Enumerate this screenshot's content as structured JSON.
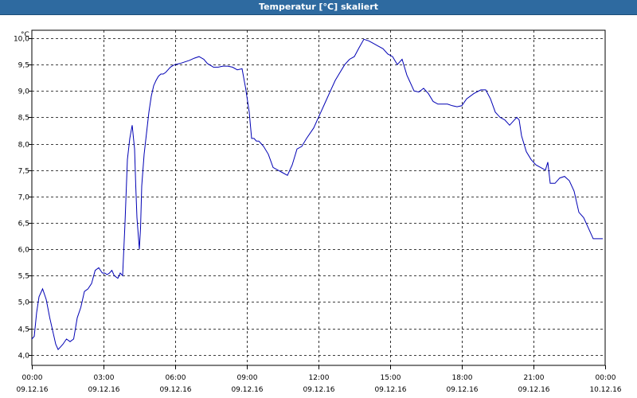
{
  "window": {
    "title": "Temperatur [°C] skaliert"
  },
  "chart_data": {
    "type": "line",
    "title": "Temperatur [°C] skaliert",
    "ylabel": "°C",
    "xlabel": "",
    "ylim": [
      3.8,
      10.15
    ],
    "xlim": [
      0,
      24
    ],
    "grid": true,
    "line_color": "#0000b4",
    "yticks": [
      4.0,
      4.5,
      5.0,
      5.5,
      6.0,
      6.5,
      7.0,
      7.5,
      8.0,
      8.5,
      9.0,
      9.5,
      10.0
    ],
    "ytick_labels": [
      "4,0",
      "4,5",
      "5,0",
      "5,5",
      "6,0",
      "6,5",
      "7,0",
      "7,5",
      "8,0",
      "8,5",
      "9,0",
      "9,5",
      "10,0"
    ],
    "xticks": [
      {
        "hour": 0,
        "time": "00:00",
        "date": "09.12.16"
      },
      {
        "hour": 3,
        "time": "03:00",
        "date": "09.12.16"
      },
      {
        "hour": 6,
        "time": "06:00",
        "date": "09.12.16"
      },
      {
        "hour": 9,
        "time": "09:00",
        "date": "09.12.16"
      },
      {
        "hour": 12,
        "time": "12:00",
        "date": "09.12.16"
      },
      {
        "hour": 15,
        "time": "15:00",
        "date": "09.12.16"
      },
      {
        "hour": 18,
        "time": "18:00",
        "date": "09.12.16"
      },
      {
        "hour": 21,
        "time": "21:00",
        "date": "09.12.16"
      },
      {
        "hour": 24,
        "time": "00:00",
        "date": "10.12.16"
      }
    ],
    "series": [
      {
        "x": [
          0.0,
          0.1,
          0.2,
          0.3,
          0.45,
          0.6,
          0.75,
          0.9,
          1.0,
          1.1,
          1.2,
          1.3,
          1.45,
          1.6,
          1.75,
          1.9,
          2.05,
          2.2,
          2.35,
          2.5,
          2.65,
          2.8,
          2.95,
          3.05,
          3.15,
          3.25,
          3.35,
          3.45,
          3.6,
          3.7,
          3.8,
          3.9,
          4.0,
          4.1,
          4.2,
          4.3,
          4.35,
          4.4,
          4.5,
          4.55,
          4.6,
          4.7,
          4.8,
          4.9,
          5.0,
          5.1,
          5.2,
          5.3,
          5.4,
          5.5,
          5.6,
          5.7,
          5.8,
          5.9,
          6.0,
          6.2,
          6.4,
          6.6,
          6.8,
          7.0,
          7.2,
          7.35,
          7.5,
          7.6,
          7.8,
          8.0,
          8.2,
          8.4,
          8.6,
          8.8,
          8.95,
          9.1,
          9.2,
          9.3,
          9.4,
          9.5,
          9.6,
          9.7,
          9.9,
          10.1,
          10.3,
          10.5,
          10.7,
          10.9,
          11.1,
          11.3,
          11.5,
          11.8,
          11.95,
          12.1,
          12.3,
          12.5,
          12.7,
          12.9,
          13.1,
          13.3,
          13.5,
          13.7,
          13.9,
          14.1,
          14.3,
          14.5,
          14.7,
          14.9,
          15.1,
          15.3,
          15.5,
          15.6,
          15.7,
          15.8,
          15.9,
          16.0,
          16.2,
          16.4,
          16.6,
          16.8,
          17.0,
          17.2,
          17.4,
          17.6,
          17.8,
          18.0,
          18.2,
          18.5,
          18.8,
          19.0,
          19.2,
          19.4,
          19.6,
          19.8,
          20.0,
          20.2,
          20.3,
          20.4,
          20.5,
          20.7,
          20.9,
          21.1,
          21.3,
          21.5,
          21.6,
          21.7,
          21.9,
          22.1,
          22.3,
          22.5,
          22.7,
          22.9,
          23.1,
          23.3,
          23.5,
          23.7,
          23.9
        ],
        "y": [
          4.3,
          4.35,
          4.8,
          5.1,
          5.25,
          5.05,
          4.7,
          4.4,
          4.2,
          4.1,
          4.15,
          4.2,
          4.3,
          4.25,
          4.3,
          4.7,
          4.9,
          5.2,
          5.25,
          5.35,
          5.6,
          5.65,
          5.55,
          5.55,
          5.52,
          5.55,
          5.6,
          5.5,
          5.45,
          5.55,
          5.5,
          6.5,
          7.7,
          8.1,
          8.35,
          7.9,
          7.2,
          6.6,
          6.0,
          6.4,
          7.2,
          7.8,
          8.2,
          8.6,
          8.9,
          9.1,
          9.2,
          9.28,
          9.32,
          9.32,
          9.35,
          9.4,
          9.45,
          9.48,
          9.5,
          9.52,
          9.55,
          9.58,
          9.62,
          9.65,
          9.6,
          9.52,
          9.48,
          9.45,
          9.45,
          9.47,
          9.47,
          9.45,
          9.4,
          9.42,
          9.05,
          8.6,
          8.1,
          8.1,
          8.05,
          8.05,
          8.0,
          7.95,
          7.8,
          7.55,
          7.5,
          7.45,
          7.4,
          7.6,
          7.9,
          7.95,
          8.1,
          8.3,
          8.45,
          8.6,
          8.8,
          9.0,
          9.2,
          9.35,
          9.5,
          9.6,
          9.65,
          9.82,
          9.98,
          9.95,
          9.9,
          9.85,
          9.8,
          9.7,
          9.65,
          9.5,
          9.6,
          9.45,
          9.3,
          9.2,
          9.1,
          9.0,
          8.98,
          9.05,
          8.95,
          8.8,
          8.75,
          8.75,
          8.75,
          8.72,
          8.7,
          8.72,
          8.85,
          8.95,
          9.02,
          9.02,
          8.85,
          8.6,
          8.5,
          8.45,
          8.35,
          8.45,
          8.5,
          8.45,
          8.15,
          7.85,
          7.7,
          7.6,
          7.55,
          7.5,
          7.65,
          7.25,
          7.25,
          7.35,
          7.38,
          7.3,
          7.1,
          6.7,
          6.6,
          6.4,
          6.2,
          6.2,
          6.2
        ]
      }
    ]
  }
}
